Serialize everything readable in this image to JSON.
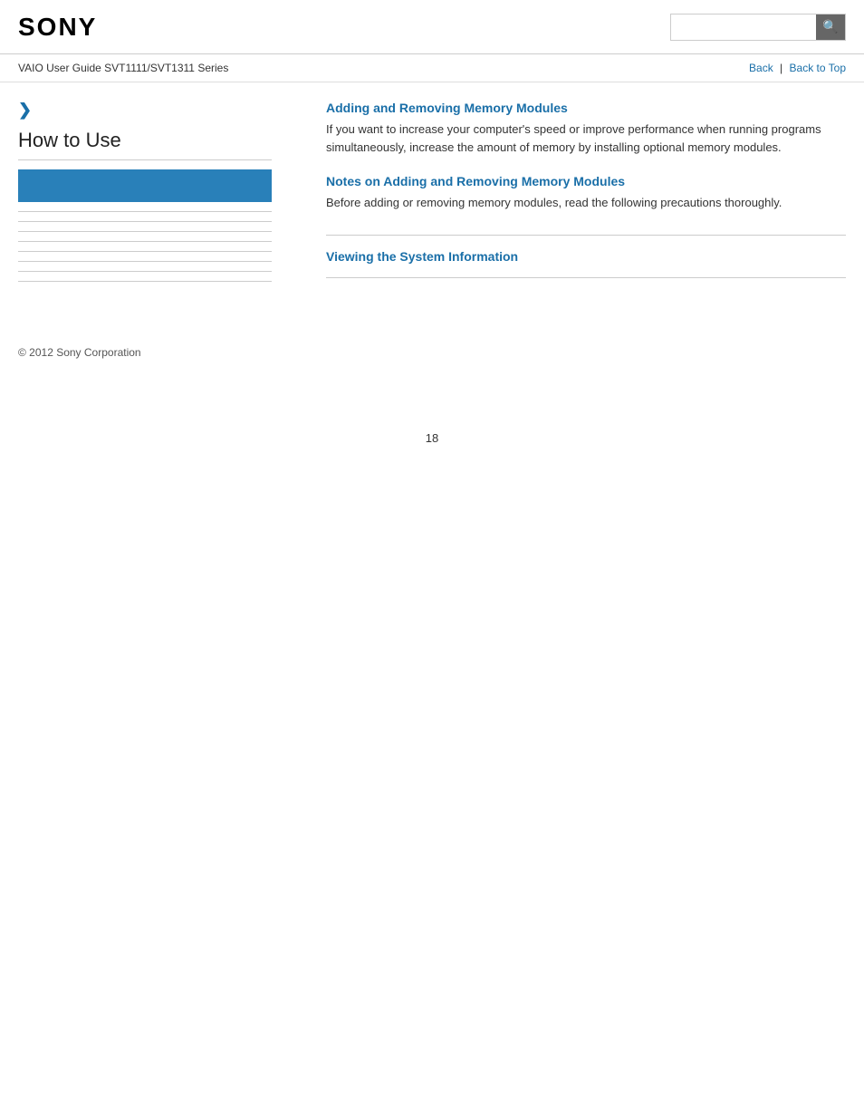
{
  "header": {
    "logo": "SONY",
    "search_placeholder": "",
    "search_icon": "🔍"
  },
  "sub_header": {
    "guide_title": "VAIO User Guide SVT1111/SVT1311 Series",
    "back_label": "Back",
    "back_to_top_label": "Back to Top"
  },
  "sidebar": {
    "chevron": "❯",
    "title": "How to Use",
    "dividers": 8
  },
  "content": {
    "sections": [
      {
        "id": "adding-removing",
        "link_text": "Adding and Removing Memory Modules",
        "description": "If you want to increase your computer's speed or improve performance when running programs simultaneously, increase the amount of memory by installing optional memory modules.",
        "has_divider": false
      },
      {
        "id": "notes-adding-removing",
        "link_text": "Notes on Adding and Removing Memory Modules",
        "description": "Before adding or removing memory modules, read the following precautions thoroughly.",
        "has_divider": true
      },
      {
        "id": "viewing-system",
        "link_text": "Viewing the System Information",
        "description": "",
        "has_divider": true
      }
    ]
  },
  "footer": {
    "copyright": "© 2012 Sony Corporation"
  },
  "page": {
    "number": "18"
  }
}
